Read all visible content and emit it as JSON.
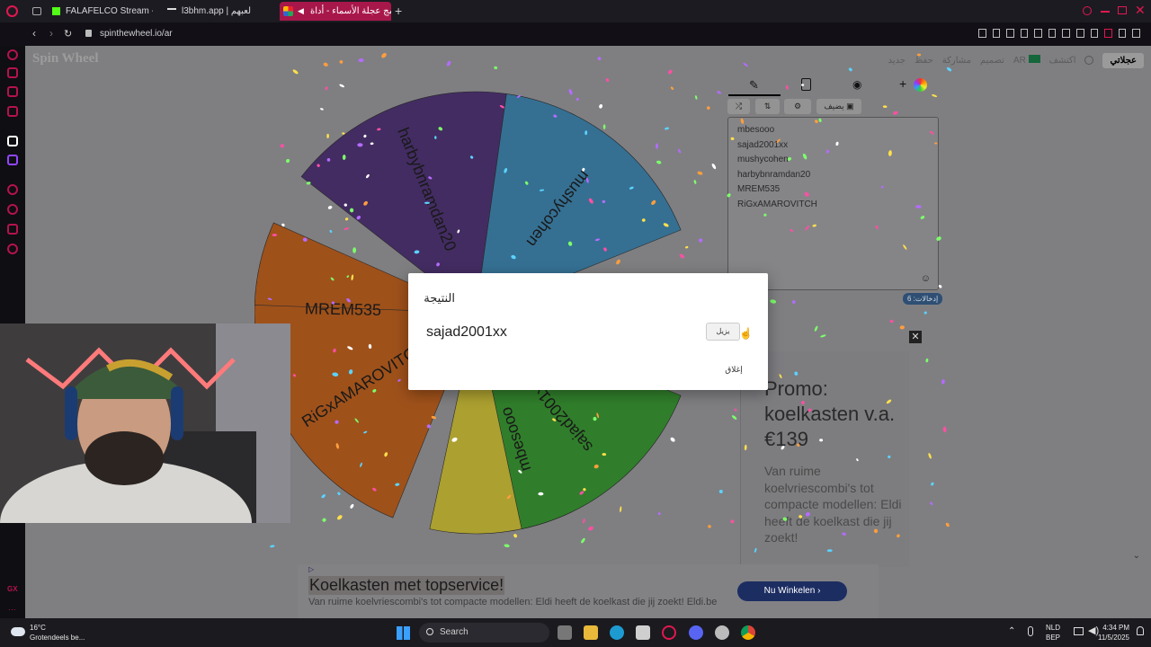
{
  "browser": {
    "tabs": [
      {
        "title": "FALAFELCO Stream - Wat",
        "favicon_color": "#53fc18"
      },
      {
        "title": "l3bhm.app | لعبهم"
      },
      {
        "title": "برنامج عجلة الأسماء - أداة",
        "active": true
      }
    ],
    "url": "spinthewheel.io/ar"
  },
  "site": {
    "brand": "Spin Wheel",
    "nav": [
      "جديد",
      "حفظ",
      "مشاركة",
      "تصميم",
      "عجلتي",
      "اكتشف",
      "عجلاتي"
    ],
    "nav_lang": "AR"
  },
  "wheel": {
    "segments": [
      {
        "name": "mushycohen",
        "color": "#2f6f95"
      },
      {
        "name": "harbybnramdan20",
        "color": "#3e2560"
      },
      {
        "name": "MREM535",
        "color": "#a24e12"
      },
      {
        "name": "RiGxAMAROVITCH",
        "color": "#a24e12"
      },
      {
        "name": "mbesooo",
        "color": "#b0a32a"
      },
      {
        "name": "sajad2001xx",
        "color": "#2a7e24"
      }
    ]
  },
  "panel": {
    "toolbar": {
      "add_image_label": "يضيف"
    },
    "entries": [
      "mbesooo",
      "sajad2001xx",
      "mushycohen",
      "harbybnramdan20",
      "MREM535",
      "RiGxAMAROVITCH"
    ],
    "count_label": "إدخالات: 6"
  },
  "dialog": {
    "title": "النتيجة",
    "winner": "sajad2001xx",
    "remove_label": "يزيل",
    "close_label": "إغلاق"
  },
  "side_ad": {
    "headline": "Promo: koelkasten v.a. €139",
    "body": "Van ruime koelvriescombi's tot compacte modellen: Eldi heeft de koelkast die jij zoekt!"
  },
  "bottom_ad": {
    "headline": "Koelkasten met topservice!",
    "subtext": "Van ruime koelvriescombi's tot compacte modellen: Eldi heeft de koelkast die jij zoekt! Eldi.be",
    "cta": "Nu Winkelen"
  },
  "taskbar": {
    "weather_temp": "16°C",
    "weather_desc": "Grotendeels be...",
    "search_label": "Search",
    "lang_top": "NLD",
    "lang_bottom": "BEP",
    "time": "4:34 PM",
    "date": "11/5/2025"
  }
}
